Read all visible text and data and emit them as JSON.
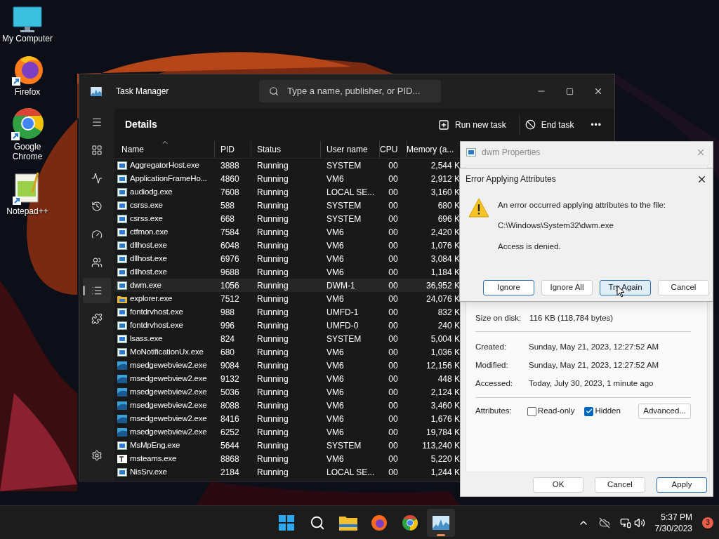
{
  "desktop_icons": [
    {
      "label": "My Computer",
      "kind": "computer"
    },
    {
      "label": "Firefox",
      "kind": "firefox"
    },
    {
      "label": "Google Chrome",
      "kind": "chrome"
    },
    {
      "label": "Notepad++",
      "kind": "notepad"
    }
  ],
  "task_manager": {
    "title": "Task Manager",
    "search": {
      "placeholder": "Type a name, publisher, or PID..."
    },
    "nav_items": [
      {
        "kind": "menu",
        "selected": false
      },
      {
        "kind": "processes",
        "selected": false
      },
      {
        "kind": "performance",
        "selected": false
      },
      {
        "kind": "history",
        "selected": false
      },
      {
        "kind": "startup",
        "selected": false
      },
      {
        "kind": "users",
        "selected": false
      },
      {
        "kind": "details",
        "selected": true
      },
      {
        "kind": "services",
        "selected": false
      },
      {
        "kind": "settings",
        "selected": false
      }
    ],
    "page_title": "Details",
    "actions": [
      {
        "kind": "run",
        "label": "Run new task"
      },
      {
        "kind": "end",
        "label": "End task"
      },
      {
        "kind": "more",
        "label": "•••"
      }
    ],
    "table": {
      "columns": [
        "Name",
        "PID",
        "Status",
        "User name",
        "CPU",
        "Memory (a..."
      ],
      "rows": [
        {
          "kind": "app",
          "name": "AggregatorHost.exe",
          "pid": "3888",
          "status": "Running",
          "user": "SYSTEM",
          "cpu": "00",
          "memory": "2,544 K",
          "selected": false
        },
        {
          "kind": "app",
          "name": "ApplicationFrameHo...",
          "pid": "4860",
          "status": "Running",
          "user": "VM6",
          "cpu": "00",
          "memory": "2,912 K",
          "selected": false
        },
        {
          "kind": "app",
          "name": "audiodg.exe",
          "pid": "7608",
          "status": "Running",
          "user": "LOCAL SE...",
          "cpu": "00",
          "memory": "3,160 K",
          "selected": false
        },
        {
          "kind": "app",
          "name": "csrss.exe",
          "pid": "588",
          "status": "Running",
          "user": "SYSTEM",
          "cpu": "00",
          "memory": "680 K",
          "selected": false
        },
        {
          "kind": "app",
          "name": "csrss.exe",
          "pid": "668",
          "status": "Running",
          "user": "SYSTEM",
          "cpu": "00",
          "memory": "696 K",
          "selected": false
        },
        {
          "kind": "app",
          "name": "ctfmon.exe",
          "pid": "7584",
          "status": "Running",
          "user": "VM6",
          "cpu": "00",
          "memory": "2,420 K",
          "selected": false
        },
        {
          "kind": "app",
          "name": "dllhost.exe",
          "pid": "6048",
          "status": "Running",
          "user": "VM6",
          "cpu": "00",
          "memory": "1,076 K",
          "selected": false
        },
        {
          "kind": "app",
          "name": "dllhost.exe",
          "pid": "6976",
          "status": "Running",
          "user": "VM6",
          "cpu": "00",
          "memory": "3,084 K",
          "selected": false
        },
        {
          "kind": "app",
          "name": "dllhost.exe",
          "pid": "9688",
          "status": "Running",
          "user": "VM6",
          "cpu": "00",
          "memory": "1,184 K",
          "selected": false
        },
        {
          "kind": "app",
          "name": "dwm.exe",
          "pid": "1056",
          "status": "Running",
          "user": "DWM-1",
          "cpu": "00",
          "memory": "36,952 K",
          "selected": true
        },
        {
          "kind": "folder",
          "name": "explorer.exe",
          "pid": "7512",
          "status": "Running",
          "user": "VM6",
          "cpu": "00",
          "memory": "24,076 K",
          "selected": false
        },
        {
          "kind": "app",
          "name": "fontdrvhost.exe",
          "pid": "988",
          "status": "Running",
          "user": "UMFD-1",
          "cpu": "00",
          "memory": "832 K",
          "selected": false
        },
        {
          "kind": "app",
          "name": "fontdrvhost.exe",
          "pid": "996",
          "status": "Running",
          "user": "UMFD-0",
          "cpu": "00",
          "memory": "240 K",
          "selected": false
        },
        {
          "kind": "app",
          "name": "lsass.exe",
          "pid": "824",
          "status": "Running",
          "user": "SYSTEM",
          "cpu": "00",
          "memory": "5,004 K",
          "selected": false
        },
        {
          "kind": "app",
          "name": "MoNotificationUx.exe",
          "pid": "680",
          "status": "Running",
          "user": "VM6",
          "cpu": "00",
          "memory": "1,036 K",
          "selected": false
        },
        {
          "kind": "web",
          "name": "msedgewebview2.exe",
          "pid": "9084",
          "status": "Running",
          "user": "VM6",
          "cpu": "00",
          "memory": "12,156 K",
          "selected": false
        },
        {
          "kind": "web",
          "name": "msedgewebview2.exe",
          "pid": "9132",
          "status": "Running",
          "user": "VM6",
          "cpu": "00",
          "memory": "448 K",
          "selected": false
        },
        {
          "kind": "web",
          "name": "msedgewebview2.exe",
          "pid": "5036",
          "status": "Running",
          "user": "VM6",
          "cpu": "00",
          "memory": "2,124 K",
          "selected": false
        },
        {
          "kind": "web",
          "name": "msedgewebview2.exe",
          "pid": "8088",
          "status": "Running",
          "user": "VM6",
          "cpu": "00",
          "memory": "3,460 K",
          "selected": false
        },
        {
          "kind": "web",
          "name": "msedgewebview2.exe",
          "pid": "8416",
          "status": "Running",
          "user": "VM6",
          "cpu": "00",
          "memory": "1,676 K",
          "selected": false
        },
        {
          "kind": "web",
          "name": "msedgewebview2.exe",
          "pid": "6252",
          "status": "Running",
          "user": "VM6",
          "cpu": "00",
          "memory": "19,784 K",
          "selected": false
        },
        {
          "kind": "app",
          "name": "MsMpEng.exe",
          "pid": "5644",
          "status": "Running",
          "user": "SYSTEM",
          "cpu": "00",
          "memory": "113,240 K",
          "selected": false
        },
        {
          "kind": "teams",
          "name": "msteams.exe",
          "pid": "8868",
          "status": "Running",
          "user": "VM6",
          "cpu": "00",
          "memory": "5,220 K",
          "selected": false
        },
        {
          "kind": "app",
          "name": "NisSrv.exe",
          "pid": "2184",
          "status": "Running",
          "user": "LOCAL SE...",
          "cpu": "00",
          "memory": "1,244 K",
          "selected": false
        }
      ]
    }
  },
  "properties": {
    "title": "dwm Properties",
    "size_row": {
      "label": "Size on disk:",
      "value": "116 KB (118,784 bytes)"
    },
    "dates": [
      {
        "label": "Created:",
        "value": "Sunday, May 21, 2023, 12:27:52 AM"
      },
      {
        "label": "Modified:",
        "value": "Sunday, May 21, 2023, 12:27:52 AM"
      },
      {
        "label": "Accessed:",
        "value": "Today, July 30, 2023, 1 minute ago"
      }
    ],
    "attributes_label": "Attributes:",
    "attributes": [
      {
        "label": "Read-only",
        "checked": false
      },
      {
        "label": "Hidden",
        "checked": true
      }
    ],
    "advanced_button": "Advanced...",
    "buttons": [
      {
        "label": "OK",
        "default": false
      },
      {
        "label": "Cancel",
        "default": false
      },
      {
        "label": "Apply",
        "default": true
      }
    ]
  },
  "error_dialog": {
    "title": "Error Applying Attributes",
    "message": "An error occurred applying attributes to the file:",
    "path": "C:\\Windows\\System32\\dwm.exe",
    "detail": "Access is denied.",
    "buttons": [
      {
        "label": "Ignore",
        "default": true,
        "hovered": false
      },
      {
        "label": "Ignore All",
        "default": false,
        "hovered": false
      },
      {
        "label": "Try Again",
        "default": false,
        "hovered": true
      },
      {
        "label": "Cancel",
        "default": false,
        "hovered": false
      }
    ]
  },
  "taskbar": {
    "apps": [
      {
        "kind": "start",
        "active": false
      },
      {
        "kind": "search",
        "active": false
      },
      {
        "kind": "folder",
        "active": false
      },
      {
        "kind": "firefox",
        "active": false
      },
      {
        "kind": "chrome",
        "active": false
      },
      {
        "kind": "taskmgr",
        "active": true
      }
    ],
    "time": "5:37 PM",
    "date": "7/30/2023",
    "notifications": "3"
  }
}
